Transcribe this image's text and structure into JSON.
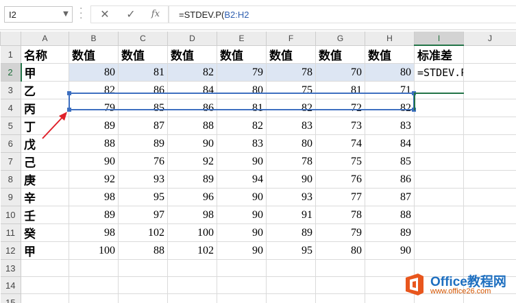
{
  "formula_bar": {
    "name_box": "I2",
    "cancel_icon": "x-icon",
    "enter_icon": "check-icon",
    "fx_label": "fx",
    "formula_prefix": "=STDEV.P(",
    "formula_ref": "B2:H2"
  },
  "sheet": {
    "columns": [
      "A",
      "B",
      "C",
      "D",
      "E",
      "F",
      "G",
      "H",
      "I",
      "J"
    ],
    "active_column": "I",
    "active_row": 2,
    "row_numbers": [
      "1",
      "2",
      "3",
      "4",
      "5",
      "6",
      "7",
      "8",
      "9",
      "10",
      "11",
      "12",
      "13",
      "14",
      "15"
    ],
    "header_row": [
      "名称",
      "数值",
      "数值",
      "数值",
      "数值",
      "数值",
      "数值",
      "数值",
      "标准差"
    ],
    "rows": [
      {
        "name": "甲",
        "values": [
          "80",
          "81",
          "82",
          "79",
          "78",
          "70",
          "80"
        ],
        "i": "=STDEV.P(B2:H2"
      },
      {
        "name": "乙",
        "values": [
          "82",
          "86",
          "84",
          "80",
          "75",
          "81",
          "71"
        ],
        "i": ""
      },
      {
        "name": "丙",
        "values": [
          "79",
          "85",
          "86",
          "81",
          "82",
          "72",
          "82"
        ],
        "i": ""
      },
      {
        "name": "丁",
        "values": [
          "89",
          "87",
          "88",
          "82",
          "83",
          "73",
          "83"
        ],
        "i": ""
      },
      {
        "name": "戊",
        "values": [
          "88",
          "89",
          "90",
          "83",
          "80",
          "74",
          "84"
        ],
        "i": ""
      },
      {
        "name": "己",
        "values": [
          "90",
          "76",
          "92",
          "90",
          "78",
          "75",
          "85"
        ],
        "i": ""
      },
      {
        "name": "庚",
        "values": [
          "92",
          "93",
          "89",
          "94",
          "90",
          "76",
          "86"
        ],
        "i": ""
      },
      {
        "name": "辛",
        "values": [
          "98",
          "95",
          "96",
          "90",
          "93",
          "77",
          "87"
        ],
        "i": ""
      },
      {
        "name": "壬",
        "values": [
          "89",
          "97",
          "98",
          "90",
          "91",
          "78",
          "88"
        ],
        "i": ""
      },
      {
        "name": "癸",
        "values": [
          "98",
          "102",
          "100",
          "90",
          "89",
          "79",
          "89"
        ],
        "i": ""
      },
      {
        "name": "甲",
        "values": [
          "100",
          "88",
          "102",
          "90",
          "95",
          "80",
          "90"
        ],
        "i": ""
      }
    ]
  },
  "watermark": {
    "title": "Office教程网",
    "url": "www.office26.com"
  },
  "colors": {
    "reference_fill": "#dde6f3",
    "reference_border": "#3d6fc0",
    "active_green": "#217346",
    "arrow": "#e0202a"
  }
}
